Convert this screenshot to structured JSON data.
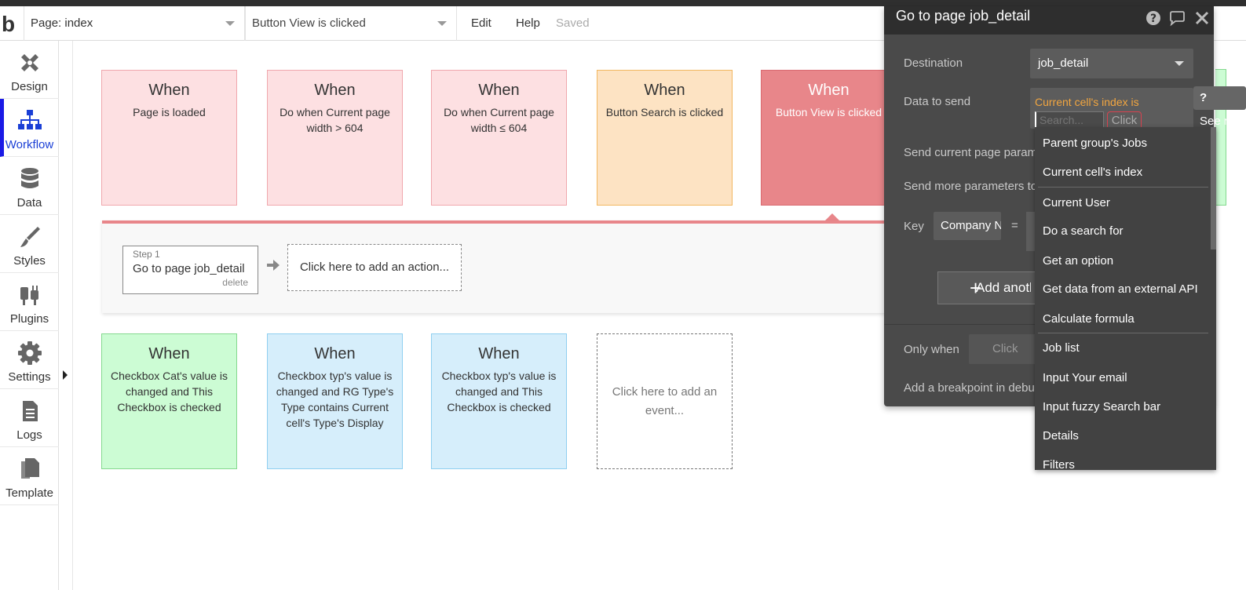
{
  "app": {
    "logo": "b",
    "page_selector": "Page: index",
    "event_selector": "Button View is clicked",
    "menu": {
      "edit": "Edit",
      "help": "Help",
      "status": "Saved"
    }
  },
  "sidebar": {
    "items": [
      {
        "label": "Design",
        "icon": "design-icon"
      },
      {
        "label": "Workflow",
        "icon": "workflow-icon",
        "active": true
      },
      {
        "label": "Data",
        "icon": "database-icon"
      },
      {
        "label": "Styles",
        "icon": "brush-icon"
      },
      {
        "label": "Plugins",
        "icon": "plug-icon"
      },
      {
        "label": "Settings",
        "icon": "gear-icon"
      },
      {
        "label": "Logs",
        "icon": "document-icon"
      },
      {
        "label": "Template",
        "icon": "template-icon"
      }
    ]
  },
  "events": [
    {
      "when": "When",
      "condition": "Page is loaded",
      "color": "pink"
    },
    {
      "when": "When",
      "condition": "Do when Current page width > 604",
      "color": "pink"
    },
    {
      "when": "When",
      "condition": "Do when Current page width ≤ 604",
      "color": "pink"
    },
    {
      "when": "When",
      "condition": "Button Search is clicked",
      "color": "orange"
    },
    {
      "when": "When",
      "condition": "Button View is clicked",
      "color": "red",
      "selected": true
    },
    {
      "when": "When",
      "condition": "Checkbox Cat's value is changed and This Checkbox is checked",
      "color": "green"
    },
    {
      "when": "When",
      "condition": "Checkbox typ's value is changed and RG Type's Type contains Current cell's Type's Display",
      "color": "blue"
    },
    {
      "when": "When",
      "condition": "Checkbox typ's value is changed and This Checkbox is checked",
      "color": "blue"
    }
  ],
  "add_event": "Click here to add an event...",
  "actions": {
    "step_number": "Step 1",
    "step_name": "Go to page job_detail",
    "step_delete": "delete",
    "add_action": "Click here to add an action..."
  },
  "panel": {
    "title": "Go to page job_detail",
    "destination_label": "Destination",
    "destination_value": "job_detail",
    "data_label": "Data to send",
    "data_expression": "Current cell's index is",
    "search_placeholder": "Search...",
    "click_label": "Click",
    "send_params_label": "Send current page parameters",
    "more_params_label": "Send more parameters to the page",
    "key_label": "Key",
    "key_value": "Company Name",
    "equals": "=",
    "add_button": "Add another parameter",
    "only_when_label": "Only when",
    "only_when_placeholder": "Click",
    "breakpoint_label": "Add a breakpoint in debug mode",
    "see_reference": "See reference"
  },
  "dropdown": {
    "groups": [
      [
        "Parent group's Jobs",
        "Current cell's index"
      ],
      [
        "Current User",
        "Do a search for",
        "Get an option",
        "Get data from an external API",
        "Calculate formula"
      ],
      [
        "Job list",
        "Input Your email",
        "Input fuzzy Search bar",
        "Details",
        "Filters"
      ]
    ]
  },
  "colors": {
    "accent_blue": "#1a1ae6",
    "selected_event": "#e8868a",
    "panel_bg": "#4a4a4a",
    "expression_orange": "#f2a640"
  }
}
